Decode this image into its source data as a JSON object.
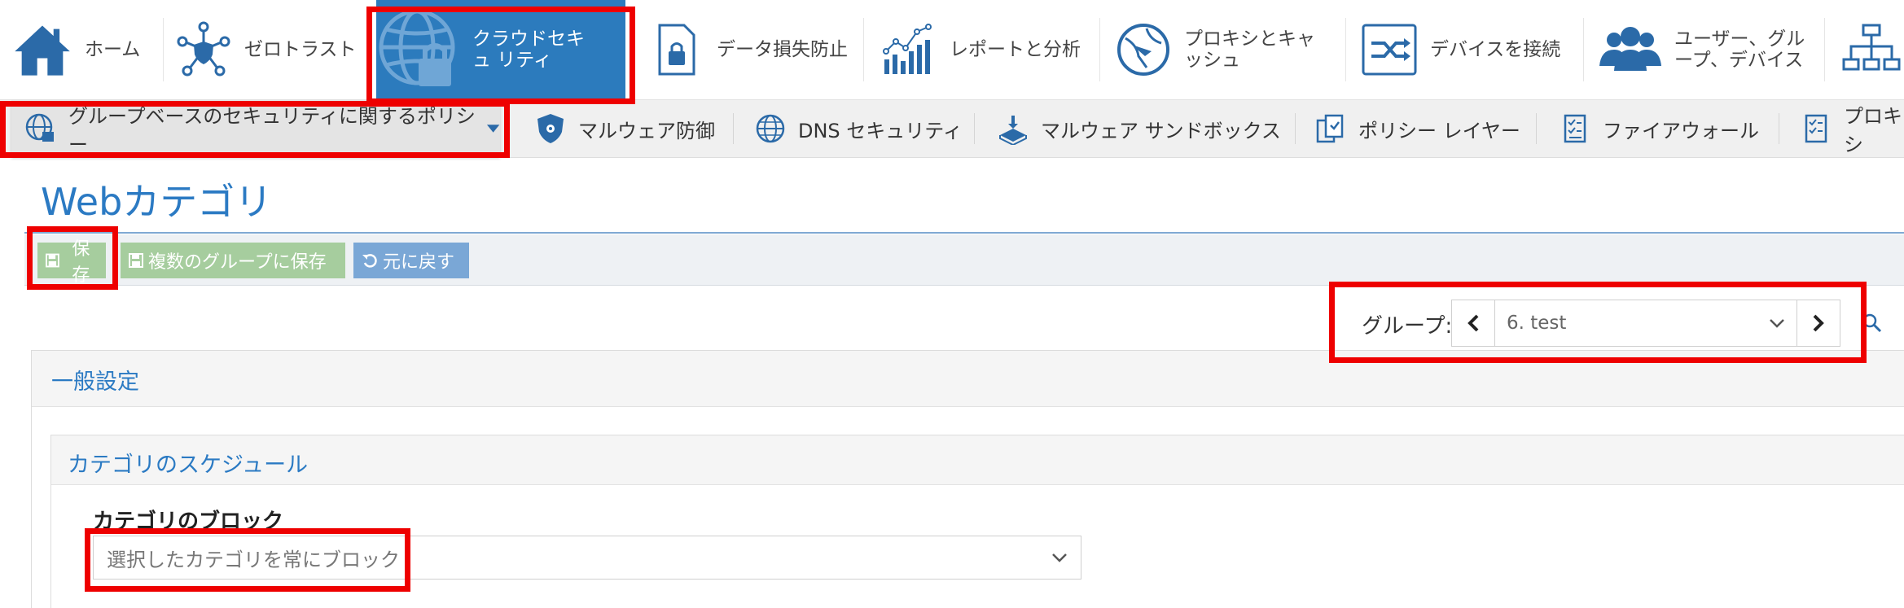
{
  "top_nav": {
    "items": [
      {
        "label": "ホーム",
        "icon": "home-icon"
      },
      {
        "label": "ゼロトラスト",
        "icon": "zero-trust-icon"
      },
      {
        "label": "クラウドセキュ リティ",
        "icon": "cloud-security-globe-lock-icon",
        "active": true
      },
      {
        "label": "データ損失防止",
        "icon": "data-loss-lock-icon"
      },
      {
        "label": "レポートと分析",
        "icon": "report-chart-icon"
      },
      {
        "label": "プロキシとキャ ッシュ",
        "icon": "proxy-cache-icon"
      },
      {
        "label": "デバイスを接続",
        "icon": "connect-device-icon"
      },
      {
        "label": "ユーザー、グル ープ、デバイス",
        "icon": "users-icon"
      }
    ]
  },
  "sub_nav": {
    "items": [
      {
        "label": "グループベースのセキュリティに関するポリシー",
        "icon": "globe-shield-icon",
        "has_dropdown": true
      },
      {
        "label": "マルウェア防御",
        "icon": "biohazard-shield-icon"
      },
      {
        "label": "DNS セキュリティ",
        "icon": "dns-globe-icon"
      },
      {
        "label": "マルウェア サンドボックス",
        "icon": "sandbox-icon"
      },
      {
        "label": "ポリシー レイヤー",
        "icon": "policy-layer-icon"
      },
      {
        "label": "ファイアウォール",
        "icon": "firewall-checklist-icon"
      },
      {
        "label": "プロキシ",
        "icon": "proxy-checklist-icon"
      }
    ]
  },
  "page": {
    "title": "Webカテゴリ"
  },
  "toolbar": {
    "save_label": "保存",
    "save_multi_label": "複数のグループに保存",
    "revert_label": "元に戻す"
  },
  "group_selector": {
    "label": "グループ:",
    "selected": "6. test"
  },
  "general": {
    "title": "一般設定",
    "schedule": {
      "title": "カテゴリのスケジュール",
      "block_label": "カテゴリのブロック",
      "block_value": "選択したカテゴリを常にブロック"
    }
  },
  "colors": {
    "accent": "#2b7ac3",
    "nav_active": "#2c7bbd",
    "save_green": "#a6cd9e",
    "revert_blue": "#7aa7d6",
    "highlight": "#ee0000"
  }
}
